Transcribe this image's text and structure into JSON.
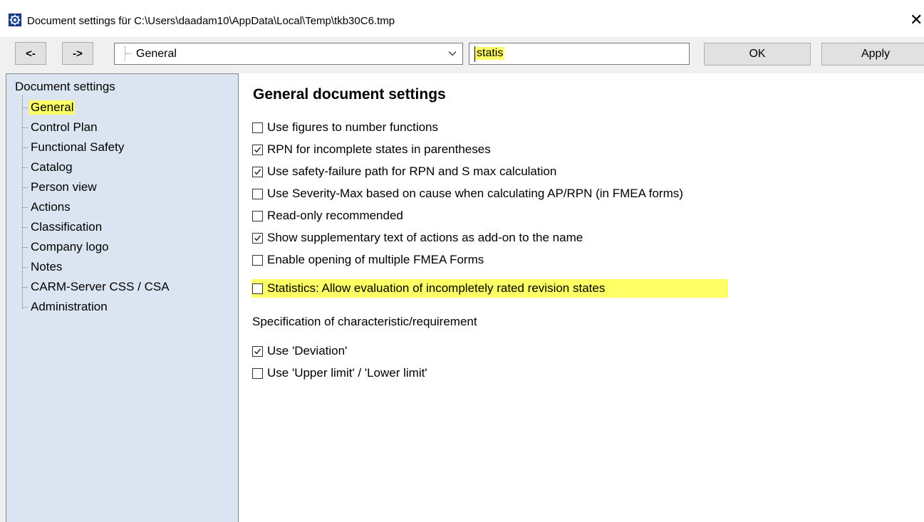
{
  "window": {
    "title": "Document settings für C:\\Users\\daadam10\\AppData\\Local\\Temp\\tkb30C6.tmp",
    "close_glyph": "✕",
    "app_icon": "settings-gear-app-icon"
  },
  "toolbar": {
    "back_label": "<-",
    "forward_label": "->",
    "section_combo_value": "General",
    "search_value": "statis",
    "ok_label": "OK",
    "apply_label": "Apply"
  },
  "sidebar": {
    "root_label": "Document settings",
    "items": [
      {
        "label": "General",
        "selected": true
      },
      {
        "label": "Control Plan",
        "selected": false
      },
      {
        "label": "Functional Safety",
        "selected": false
      },
      {
        "label": "Catalog",
        "selected": false
      },
      {
        "label": "Person view",
        "selected": false
      },
      {
        "label": "Actions",
        "selected": false
      },
      {
        "label": "Classification",
        "selected": false
      },
      {
        "label": "Company logo",
        "selected": false
      },
      {
        "label": "Notes",
        "selected": false
      },
      {
        "label": "CARM-Server CSS / CSA",
        "selected": false
      },
      {
        "label": "Administration",
        "selected": false
      }
    ]
  },
  "main": {
    "heading": "General document settings",
    "options": [
      {
        "label": "Use figures to number functions",
        "checked": false
      },
      {
        "label": "RPN for incomplete states in parentheses",
        "checked": true
      },
      {
        "label": "Use safety-failure path for RPN and S max calculation",
        "checked": true
      },
      {
        "label": "Use Severity-Max based on cause when calculating AP/RPN (in FMEA forms)",
        "checked": false
      },
      {
        "label": "Read-only recommended",
        "checked": false
      },
      {
        "label": "Show supplementary text of actions as add-on to the name",
        "checked": true
      },
      {
        "label": "Enable opening of multiple FMEA Forms",
        "checked": false
      },
      {
        "label": "Statistics: Allow evaluation of incompletely rated revision states",
        "checked": false,
        "highlighted": true
      }
    ],
    "spec_section_label": "Specification of characteristic/requirement",
    "spec_options": [
      {
        "label": "Use 'Deviation'",
        "checked": true
      },
      {
        "label": "Use 'Upper limit' / 'Lower limit'",
        "checked": false
      }
    ]
  },
  "colors": {
    "highlight": "#ffff66",
    "sidebar_bg": "#dbe5f1",
    "button_bg": "#e1e1e1"
  }
}
